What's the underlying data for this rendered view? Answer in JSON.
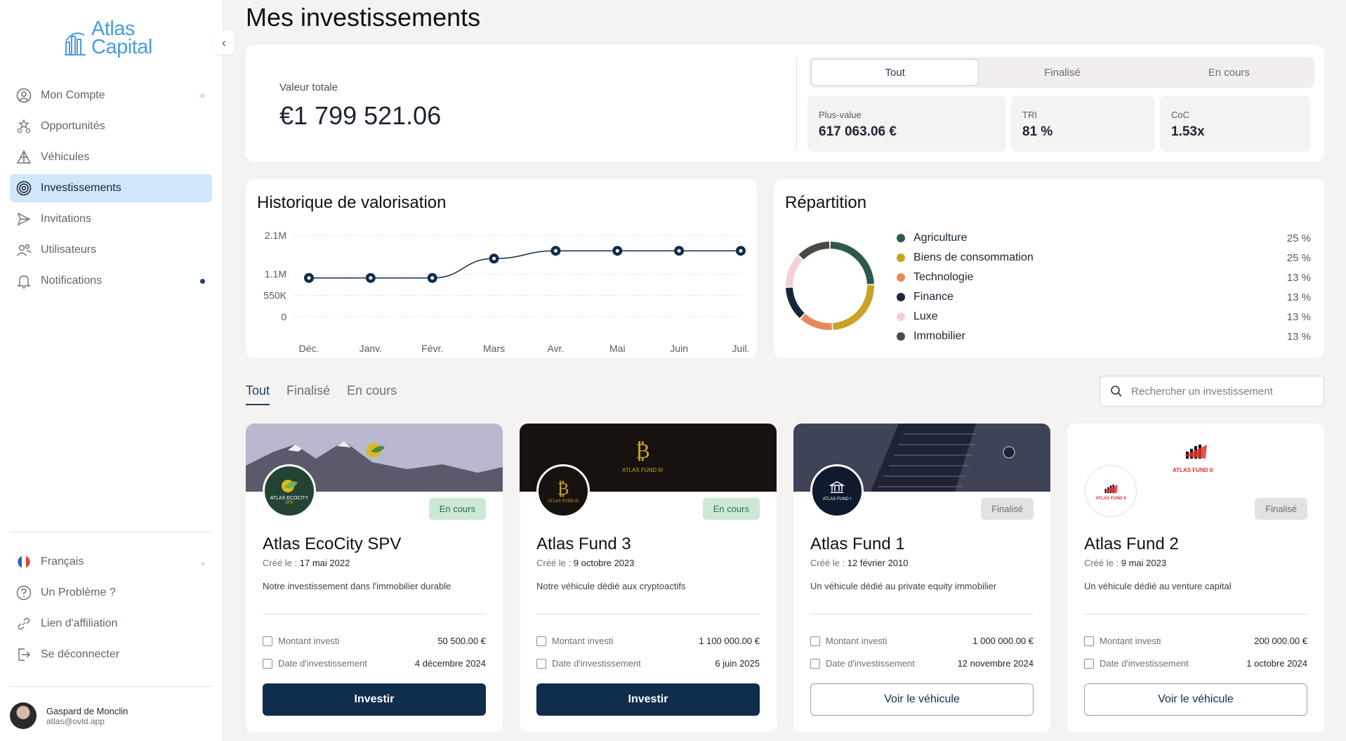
{
  "brand": {
    "name_line1": "Atlas",
    "name_line2": "Capital"
  },
  "sidebar": {
    "items": [
      {
        "label": "Mon Compte"
      },
      {
        "label": "Opportunités"
      },
      {
        "label": "Véhicules"
      },
      {
        "label": "Investissements"
      },
      {
        "label": "Invitations"
      },
      {
        "label": "Utilisateurs"
      },
      {
        "label": "Notifications"
      }
    ],
    "bottom": [
      {
        "label": "Français"
      },
      {
        "label": "Un Problème ?"
      },
      {
        "label": "Lien d'affiliation"
      },
      {
        "label": "Se déconnecter"
      }
    ],
    "user": {
      "name": "Gaspard de Monclin",
      "email": "atlas@ovld.app"
    }
  },
  "page": {
    "title": "Mes investissements"
  },
  "summary": {
    "total_label": "Valeur totale",
    "total_value": "€1 799 521.06",
    "segments": [
      "Tout",
      "Finalisé",
      "En cours"
    ],
    "kpis": [
      {
        "label": "Plus-value",
        "value": "617 063.06 €"
      },
      {
        "label": "TRI",
        "value": "81 %"
      },
      {
        "label": "CoC",
        "value": "1.53x"
      }
    ]
  },
  "history": {
    "title": "Historique de valorisation"
  },
  "chart_data": {
    "type": "line",
    "title": "Historique de valorisation",
    "categories": [
      "Déc.",
      "Janv.",
      "Févr.",
      "Mars",
      "Avr.",
      "Mai",
      "Juin",
      "Juil."
    ],
    "values": [
      1000000,
      1000000,
      1000000,
      1500000,
      1700000,
      1700000,
      1700000,
      1700000
    ],
    "yticks": [
      "2.1M",
      "1.1M",
      "550K",
      "0"
    ],
    "ytick_values": [
      2100000,
      1100000,
      550000,
      0
    ],
    "ylim": [
      0,
      2100000
    ],
    "grid": true
  },
  "repartition": {
    "title": "Répartition",
    "items": [
      {
        "label": "Agriculture",
        "pct": "25 %",
        "value": 25,
        "color": "#2e5a48"
      },
      {
        "label": "Biens de consommation",
        "pct": "25 %",
        "value": 25,
        "color": "#c9a227"
      },
      {
        "label": "Technologie",
        "pct": "13 %",
        "value": 13,
        "color": "#e8895c"
      },
      {
        "label": "Finance",
        "pct": "13 %",
        "value": 13,
        "color": "#18263b"
      },
      {
        "label": "Luxe",
        "pct": "13 %",
        "value": 13,
        "color": "#f7cfd2"
      },
      {
        "label": "Immobilier",
        "pct": "13 %",
        "value": 13,
        "color": "#4a4a40"
      }
    ]
  },
  "filter_tabs": [
    "Tout",
    "Finalisé",
    "En cours"
  ],
  "search": {
    "placeholder": "Rechercher un investissement"
  },
  "funds": [
    {
      "name": "Atlas EcoCity SPV",
      "created_label": "Créé le :",
      "created": "17 mai 2022",
      "desc": "Notre investissement dans l'immobilier durable",
      "status": "En cours",
      "amount_label": "Montant investi",
      "amount": "50 500.00 €",
      "date_label": "Date d'investissement",
      "date": "4 décembre 2024",
      "action": "Investir",
      "logo_text": "ATLAS ECOCITY",
      "logo_sub": "SPV"
    },
    {
      "name": "Atlas Fund 3",
      "created_label": "Créé le :",
      "created": "9 octobre 2023",
      "desc": "Notre véhicule dédié aux cryptoactifs",
      "status": "En cours",
      "amount_label": "Montant investi",
      "amount": "1 100 000.00 €",
      "date_label": "Date d'investissement",
      "date": "6 juin 2025",
      "action": "Investir",
      "logo_text": "ATLAS FUND III",
      "banner_text": "ATLAS FUND III"
    },
    {
      "name": "Atlas Fund 1",
      "created_label": "Créé le :",
      "created": "12 février 2010",
      "desc": "Un véhicule dédié au private equity immobilier",
      "status": "Finalisé",
      "amount_label": "Montant investi",
      "amount": "1 000 000.00 €",
      "date_label": "Date d'investissement",
      "date": "12 novembre 2024",
      "action": "Voir le véhicule",
      "logo_text": "ATLAS FUND I"
    },
    {
      "name": "Atlas Fund 2",
      "created_label": "Créé le :",
      "created": "9 mai 2023",
      "desc": "Un véhicule dédié au venture capital",
      "status": "Finalisé",
      "amount_label": "Montant investi",
      "amount": "200 000.00 €",
      "date_label": "Date d'investissement",
      "date": "1 octobre 2024",
      "action": "Voir le véhicule",
      "logo_text": "ATLAS FUND II",
      "banner_text": "ATLAS FUND II"
    }
  ]
}
